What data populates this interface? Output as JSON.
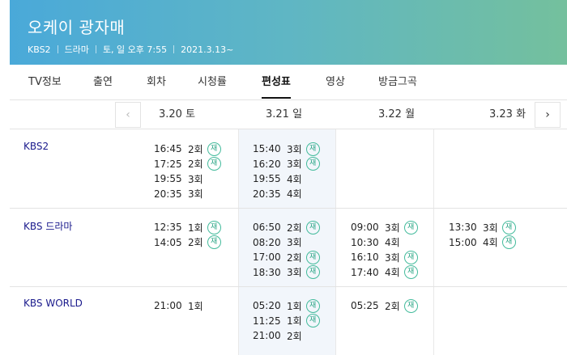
{
  "header": {
    "title": "오케이 광자매",
    "channel": "KBS2",
    "genre": "드라마",
    "airtime": "토, 일 오후 7:55",
    "start_date": "2021.3.13~"
  },
  "tabs": [
    {
      "label": "TV정보"
    },
    {
      "label": "출연"
    },
    {
      "label": "회차"
    },
    {
      "label": "시청률"
    },
    {
      "label": "편성표",
      "active": true
    },
    {
      "label": "영상"
    },
    {
      "label": "방금그곡"
    }
  ],
  "datebar": {
    "prev_icon": "‹",
    "next_icon": "›",
    "dates": [
      "3.20 토",
      "3.21 일",
      "3.22 월",
      "3.23 화"
    ]
  },
  "rerun_label": "재",
  "schedule": [
    {
      "channel": "KBS2",
      "days": [
        [
          {
            "time": "16:45",
            "ep": "2회",
            "rerun": true
          },
          {
            "time": "17:25",
            "ep": "2회",
            "rerun": true
          },
          {
            "time": "19:55",
            "ep": "3회",
            "rerun": false
          },
          {
            "time": "20:35",
            "ep": "3회",
            "rerun": false
          }
        ],
        [
          {
            "time": "15:40",
            "ep": "3회",
            "rerun": true
          },
          {
            "time": "16:20",
            "ep": "3회",
            "rerun": true
          },
          {
            "time": "19:55",
            "ep": "4회",
            "rerun": false
          },
          {
            "time": "20:35",
            "ep": "4회",
            "rerun": false
          }
        ],
        [],
        []
      ]
    },
    {
      "channel": "KBS 드라마",
      "days": [
        [
          {
            "time": "12:35",
            "ep": "1회",
            "rerun": true
          },
          {
            "time": "14:05",
            "ep": "2회",
            "rerun": true
          }
        ],
        [
          {
            "time": "06:50",
            "ep": "2회",
            "rerun": true
          },
          {
            "time": "08:20",
            "ep": "3회",
            "rerun": false
          },
          {
            "time": "17:00",
            "ep": "2회",
            "rerun": true
          },
          {
            "time": "18:30",
            "ep": "3회",
            "rerun": true
          }
        ],
        [
          {
            "time": "09:00",
            "ep": "3회",
            "rerun": true
          },
          {
            "time": "10:30",
            "ep": "4회",
            "rerun": false
          },
          {
            "time": "16:10",
            "ep": "3회",
            "rerun": true
          },
          {
            "time": "17:40",
            "ep": "4회",
            "rerun": true
          }
        ],
        [
          {
            "time": "13:30",
            "ep": "3회",
            "rerun": true
          },
          {
            "time": "15:00",
            "ep": "4회",
            "rerun": true
          }
        ]
      ]
    },
    {
      "channel": "KBS WORLD",
      "days": [
        [
          {
            "time": "21:00",
            "ep": "1회",
            "rerun": false
          }
        ],
        [
          {
            "time": "05:20",
            "ep": "1회",
            "rerun": true
          },
          {
            "time": "11:25",
            "ep": "1회",
            "rerun": true
          },
          {
            "time": "21:00",
            "ep": "2회",
            "rerun": false
          }
        ],
        [
          {
            "time": "05:25",
            "ep": "2회",
            "rerun": true
          }
        ],
        []
      ]
    }
  ]
}
